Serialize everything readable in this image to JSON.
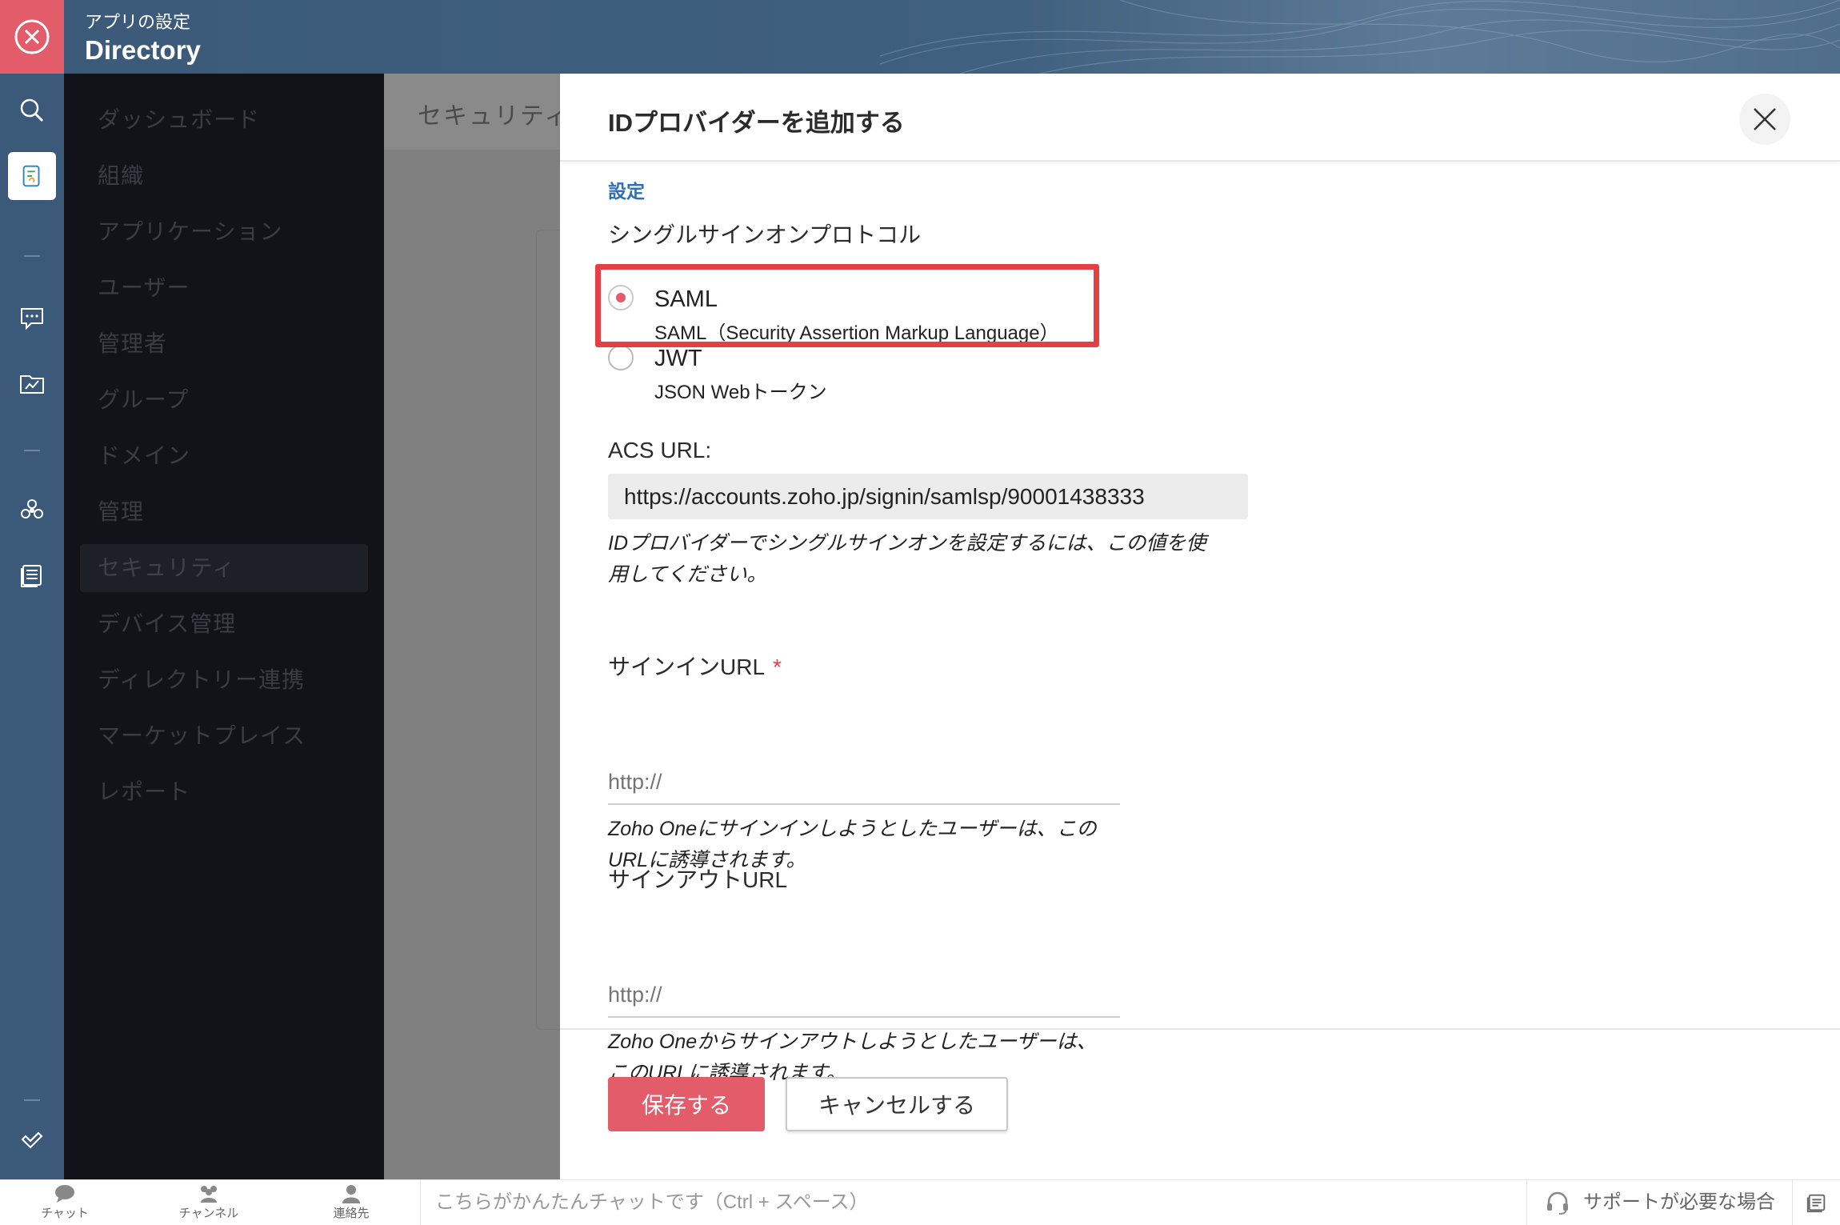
{
  "header": {
    "subtitle": "アプリの設定",
    "title": "Directory"
  },
  "nav": {
    "items": [
      {
        "label": "ダッシュボード"
      },
      {
        "label": "組織"
      },
      {
        "label": "アプリケーション"
      },
      {
        "label": "ユーザー"
      },
      {
        "label": "管理者"
      },
      {
        "label": "グループ"
      },
      {
        "label": "ドメイン"
      },
      {
        "label": "管理"
      },
      {
        "label": "セキュリティ"
      },
      {
        "label": "デバイス管理"
      },
      {
        "label": "ディレクトリー連携"
      },
      {
        "label": "マーケットプレイス"
      },
      {
        "label": "レポート"
      }
    ],
    "active": "セキュリティ"
  },
  "main": {
    "subheading": "セキュリティ"
  },
  "panel": {
    "title": "IDプロバイダーを追加する",
    "section_label": "設定",
    "protocol_label": "シングルサインオンプロトコル",
    "options": [
      {
        "title": "SAML",
        "subtitle": "SAML（Security Assertion Markup Language）",
        "selected": true
      },
      {
        "title": "JWT",
        "subtitle": "JSON Webトークン",
        "selected": false
      }
    ],
    "acs": {
      "label": "ACS URL:",
      "value": "https://accounts.zoho.jp/signin/samlsp/90001438333",
      "help_line1": "IDプロバイダーでシングルサインオンを設定するには、この値を使",
      "help_line2": "用してください。"
    },
    "signin": {
      "label": "サインインURL",
      "required_mark": "*",
      "placeholder": "http://",
      "help_line1": "Zoho Oneにサインインしようとしたユーザーは、この",
      "help_line2": "URLに誘導されます。"
    },
    "signout": {
      "label": "サインアウトURL",
      "placeholder": "http://",
      "help_line1": "Zoho Oneからサインアウトしようとしたユーザーは、",
      "help_line2": "このURLに誘導されます。"
    },
    "save_label": "保存する",
    "cancel_label": "キャンセルする"
  },
  "bottombar": {
    "chat": "チャット",
    "channel": "チャンネル",
    "contacts": "連絡先",
    "chat_placeholder": "こちらがかんたんチャットです（Ctrl + スペース）",
    "support": "サポートが必要な場合"
  },
  "colors": {
    "accent": "#e25c6a",
    "header": "#3b5a7a",
    "link": "#2f6fb3",
    "highlight": "#e53f46"
  }
}
